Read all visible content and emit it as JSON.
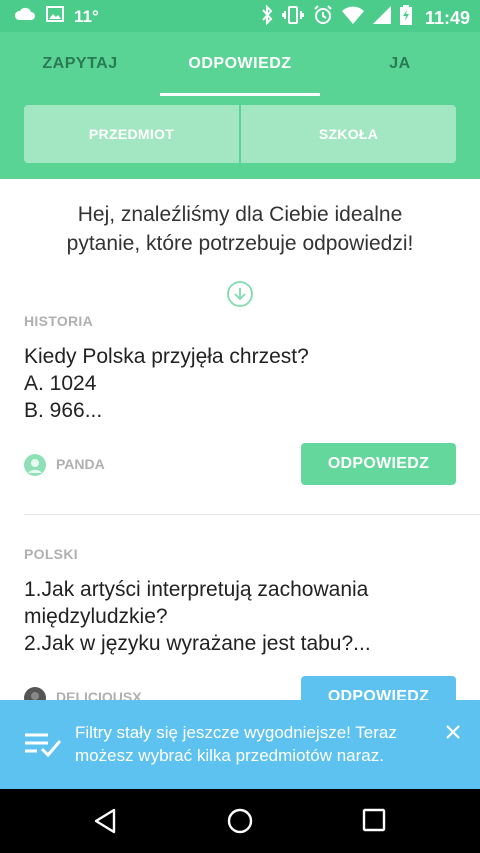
{
  "status_bar": {
    "temperature": "11°",
    "time": "11:49",
    "icons": [
      "cloud-icon",
      "image-icon",
      "bluetooth-icon",
      "vibrate-icon",
      "alarm-icon",
      "wifi-icon",
      "signal-icon",
      "battery-icon"
    ]
  },
  "tabs": [
    {
      "label": "ZAPYTAJ",
      "active": false
    },
    {
      "label": "ODPOWIEDZ",
      "active": true
    },
    {
      "label": "JA",
      "active": false
    }
  ],
  "filters": [
    {
      "label": "PRZEDMIOT"
    },
    {
      "label": "SZKOŁA"
    }
  ],
  "intro": {
    "line1": "Hej, znaleźliśmy dla Ciebie idealne",
    "line2": "pytanie, które potrzebuje odpowiedzi!"
  },
  "questions": [
    {
      "subject": "HISTORIA",
      "lines": [
        "Kiedy Polska przyjęła chrzest?",
        "A. 1024",
        "B. 966..."
      ],
      "author": "PANDA",
      "button_label": "ODPOWIEDZ"
    },
    {
      "subject": "POLSKI",
      "lines": [
        "1.Jak artyści interpretują zachowania",
        "międzyludzkie?",
        "2.Jak w języku wyrażane jest tabu?..."
      ],
      "author": "DELICIOUSX",
      "button_label": "ODPOWIEDZ"
    }
  ],
  "toast": {
    "line1": "Filtry stały się jeszcze wygodniejsze! Teraz",
    "line2": "możesz wybrać kilka przedmiotów naraz."
  },
  "colors": {
    "primary_green": "#5ad494",
    "button_green": "#63d79c",
    "toast_blue": "#5ec2f0",
    "muted_text": "#b0b0b0"
  },
  "nav_bar": {
    "icons": [
      "back-icon",
      "home-icon",
      "recents-icon"
    ]
  }
}
